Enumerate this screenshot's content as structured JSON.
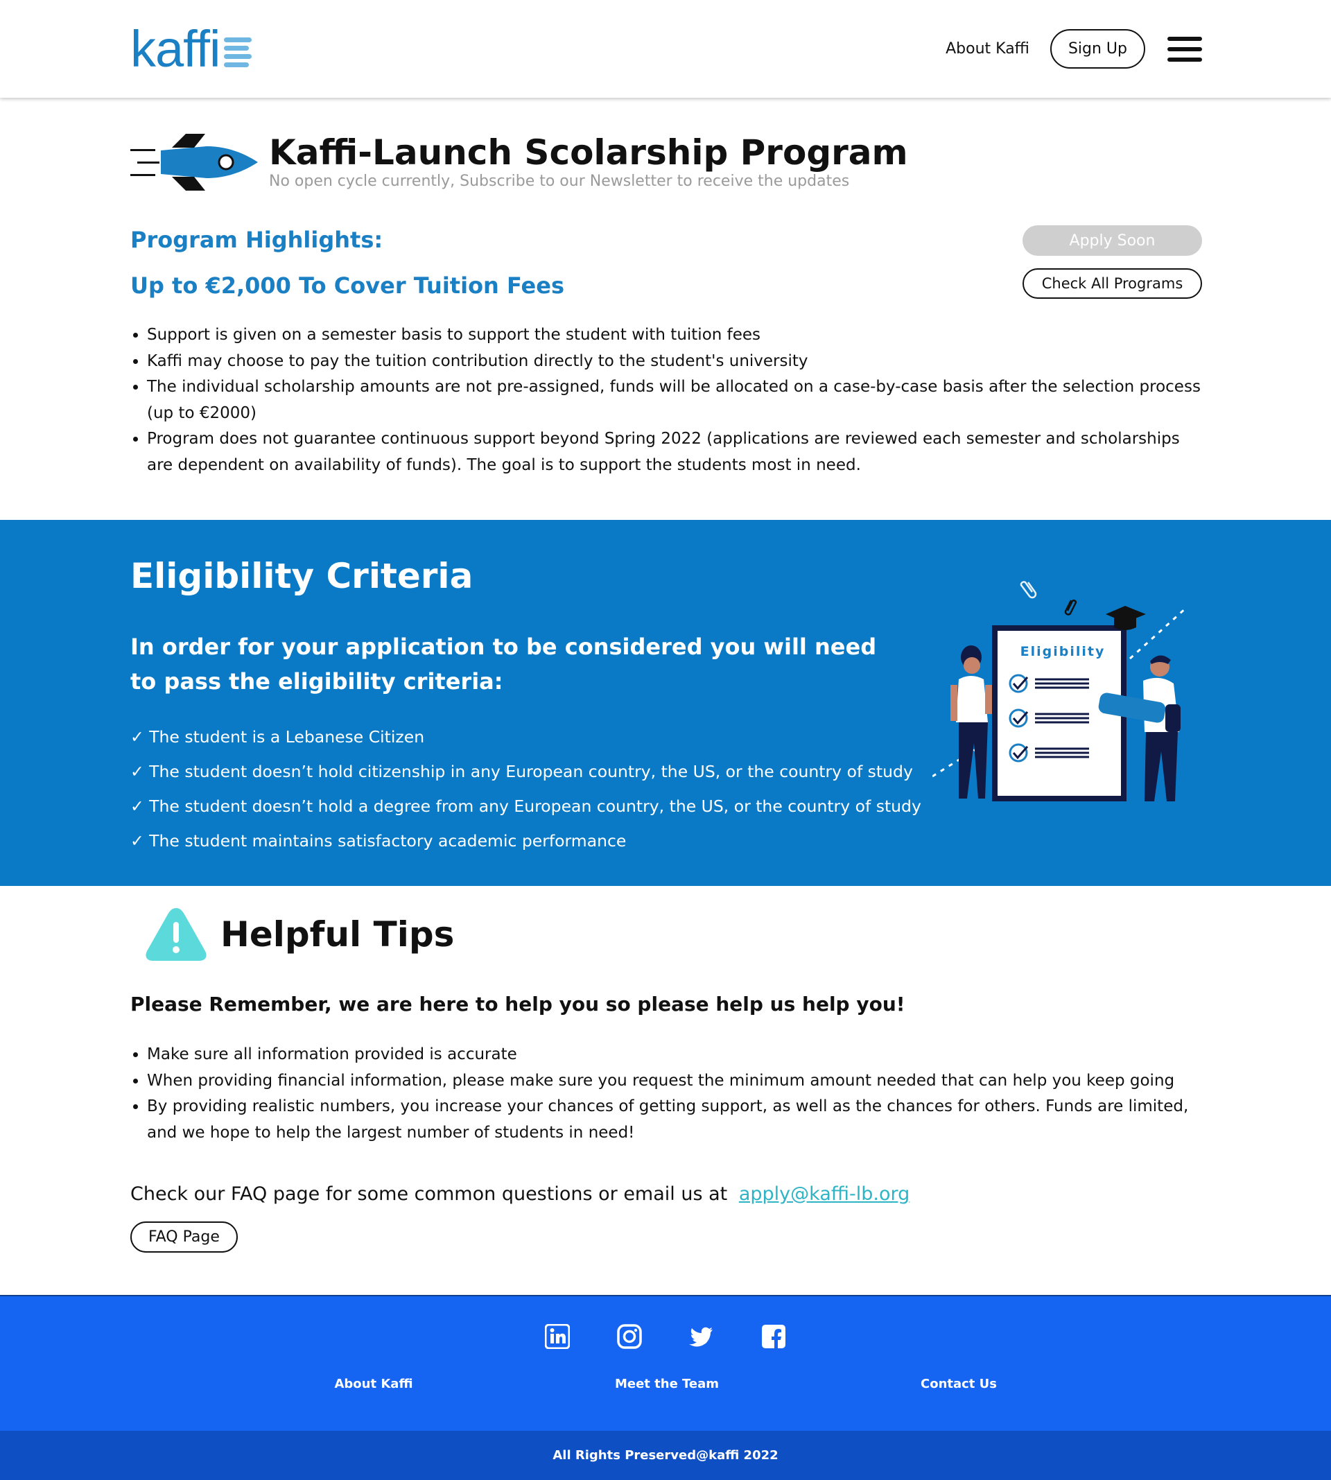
{
  "header": {
    "logo_text": "kaffi",
    "nav_about": "About Kaffi",
    "signup_label": "Sign Up",
    "menu_icon": "hamburger-menu-icon"
  },
  "program": {
    "icon": "rocket-icon",
    "title": "Kaffi-Launch Scolarship Program",
    "subtitle": "No open cycle currently, Subscribe to our Newsletter to receive the updates",
    "highlights_title": "Program Highlights:",
    "amount": "Up to €2,000 To Cover Tuition Fees",
    "apply_label": "Apply Soon",
    "check_programs_label": "Check All Programs",
    "bullets": [
      "Support is given on a semester basis to support the student with tuition fees",
      "Kaffi may choose to pay the tuition contribution directly to the student's university",
      "The individual scholarship amounts are not pre-assigned, funds will be allocated on a case-by-case basis after the selection process (up to €2000)",
      "Program does not guarantee continuous support beyond Spring 2022 (applications are reviewed each semester and scholarships are dependent on availability of funds). The goal is to support the students most in need."
    ]
  },
  "eligibility": {
    "title": "Eligibility Criteria",
    "lead": "In order for your application to be considered you will need to pass the eligibility criteria:",
    "criteria": [
      "✓ The student is a Lebanese Citizen",
      "✓ The student doesn’t hold citizenship in any European country, the US, or the country of study",
      "✓ The student doesn’t hold a degree from any European country, the US, or the country of study",
      "✓ The student maintains satisfactory academic performance"
    ],
    "illustration_label": "Eligibility"
  },
  "tips": {
    "icon": "warning-icon",
    "title": "Helpful Tips",
    "lead": "Please Remember, we are here to help you so please help us help you!",
    "bullets": [
      "Make sure all information provided is accurate",
      "When providing financial information, please make sure you request the minimum amount needed that can help you keep going",
      "By providing realistic numbers, you increase your chances of getting support, as well as the chances for others. Funds are limited, and we hope to help the largest number of students in need!"
    ],
    "faq_text": "Check our FAQ page for some common questions or email us at",
    "email": "apply@kaffi-lb.org",
    "faq_button": "FAQ Page"
  },
  "footer": {
    "social_icons": [
      "linkedin-icon",
      "instagram-icon",
      "twitter-icon",
      "facebook-icon"
    ],
    "links": [
      "About Kaffi",
      "Meet the Team",
      "Contact Us"
    ],
    "copyright": "All Rights Preserved@kaffi 2022"
  },
  "colors": {
    "brand_blue": "#1b7fc4",
    "eligibility_bg": "#0a7ac6",
    "footer_bg": "#1565f2",
    "copyright_bg": "#0f4fc4",
    "link_teal": "#2fb4c6",
    "disabled_gray": "#cfcfcf"
  }
}
